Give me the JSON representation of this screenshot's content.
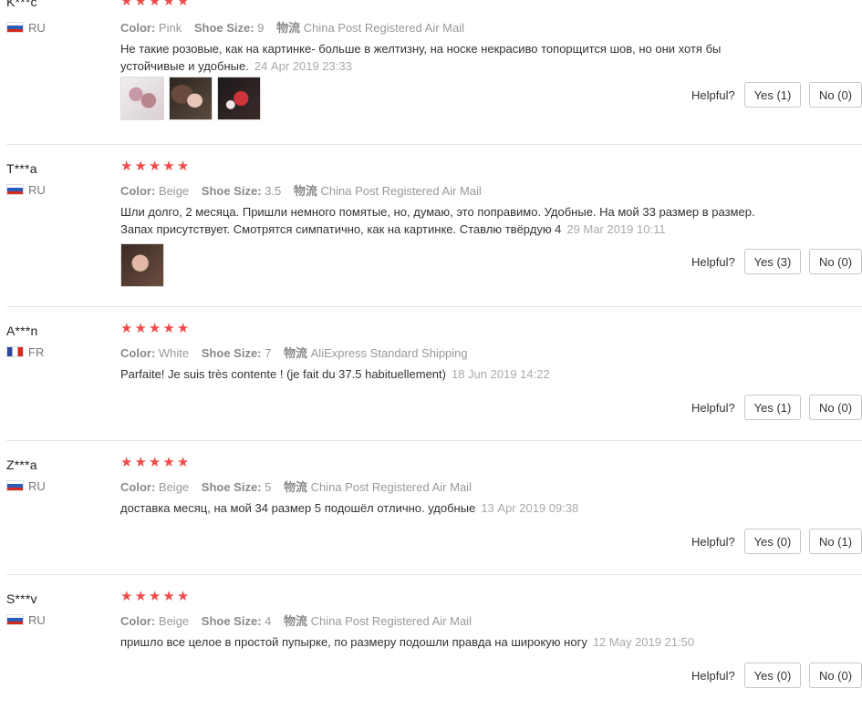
{
  "labels": {
    "color": "Color:",
    "shoe_size": "Shoe Size:",
    "shipping_prefix": "物流",
    "helpful": "Helpful?"
  },
  "colors": {
    "star": "#f04b4b",
    "separator": "#e6e6e6"
  },
  "reviews": [
    {
      "name": "K***c",
      "country": "RU",
      "flag": "flag-ru-icon",
      "rating": 5,
      "color": "Pink",
      "size": "9",
      "shipping": "China Post Registered Air Mail",
      "text": "Не такие розовые, как на картинке- больше в желтизну, на носке некрасиво топорщится шов, но они хотя бы устойчивые и удобные.",
      "date": "24 Apr 2019 23:33",
      "photos": [
        "photo-1",
        "photo-2",
        "photo-3"
      ],
      "yes": "Yes (1)",
      "no": "No (0)"
    },
    {
      "name": "T***a",
      "country": "RU",
      "flag": "flag-ru-icon",
      "rating": 5,
      "color": "Beige",
      "size": "3.5",
      "shipping": "China Post Registered Air Mail",
      "text": "Шли долго, 2 месяца. Пришли немного помятые, но, думаю, это поправимо. Удобные. На мой 33 размер в размер. Запах присутствует. Смотрятся симпатично, как на картинке. Ставлю твёрдую 4",
      "date": "29 Mar 2019 10:11",
      "photos": [
        "photo-1"
      ],
      "yes": "Yes (3)",
      "no": "No (0)"
    },
    {
      "name": "A***n",
      "country": "FR",
      "flag": "flag-fr-icon",
      "rating": 5,
      "color": "White",
      "size": "7",
      "shipping": "AliExpress Standard Shipping",
      "text": "Parfaite! Je suis très contente ! (je fait du 37.5 habituellement)",
      "date": "18 Jun 2019 14:22",
      "photos": [],
      "yes": "Yes (1)",
      "no": "No (0)"
    },
    {
      "name": "Z***a",
      "country": "RU",
      "flag": "flag-ru-icon",
      "rating": 5,
      "color": "Beige",
      "size": "5",
      "shipping": "China Post Registered Air Mail",
      "text": "доставка месяц, на мой 34 размер 5 подошёл отлично. удобные",
      "date": "13 Apr 2019 09:38",
      "photos": [],
      "yes": "Yes (0)",
      "no": "No (1)"
    },
    {
      "name": "S***v",
      "country": "RU",
      "flag": "flag-ru-icon",
      "rating": 5,
      "color": "Beige",
      "size": "4",
      "shipping": "China Post Registered Air Mail",
      "text": "пришло все целое в простой пупырке, по размеру подошли правда на широкую ногу",
      "date": "12 May 2019 21:50",
      "photos": [],
      "yes": "Yes (0)",
      "no": "No (0)"
    }
  ]
}
